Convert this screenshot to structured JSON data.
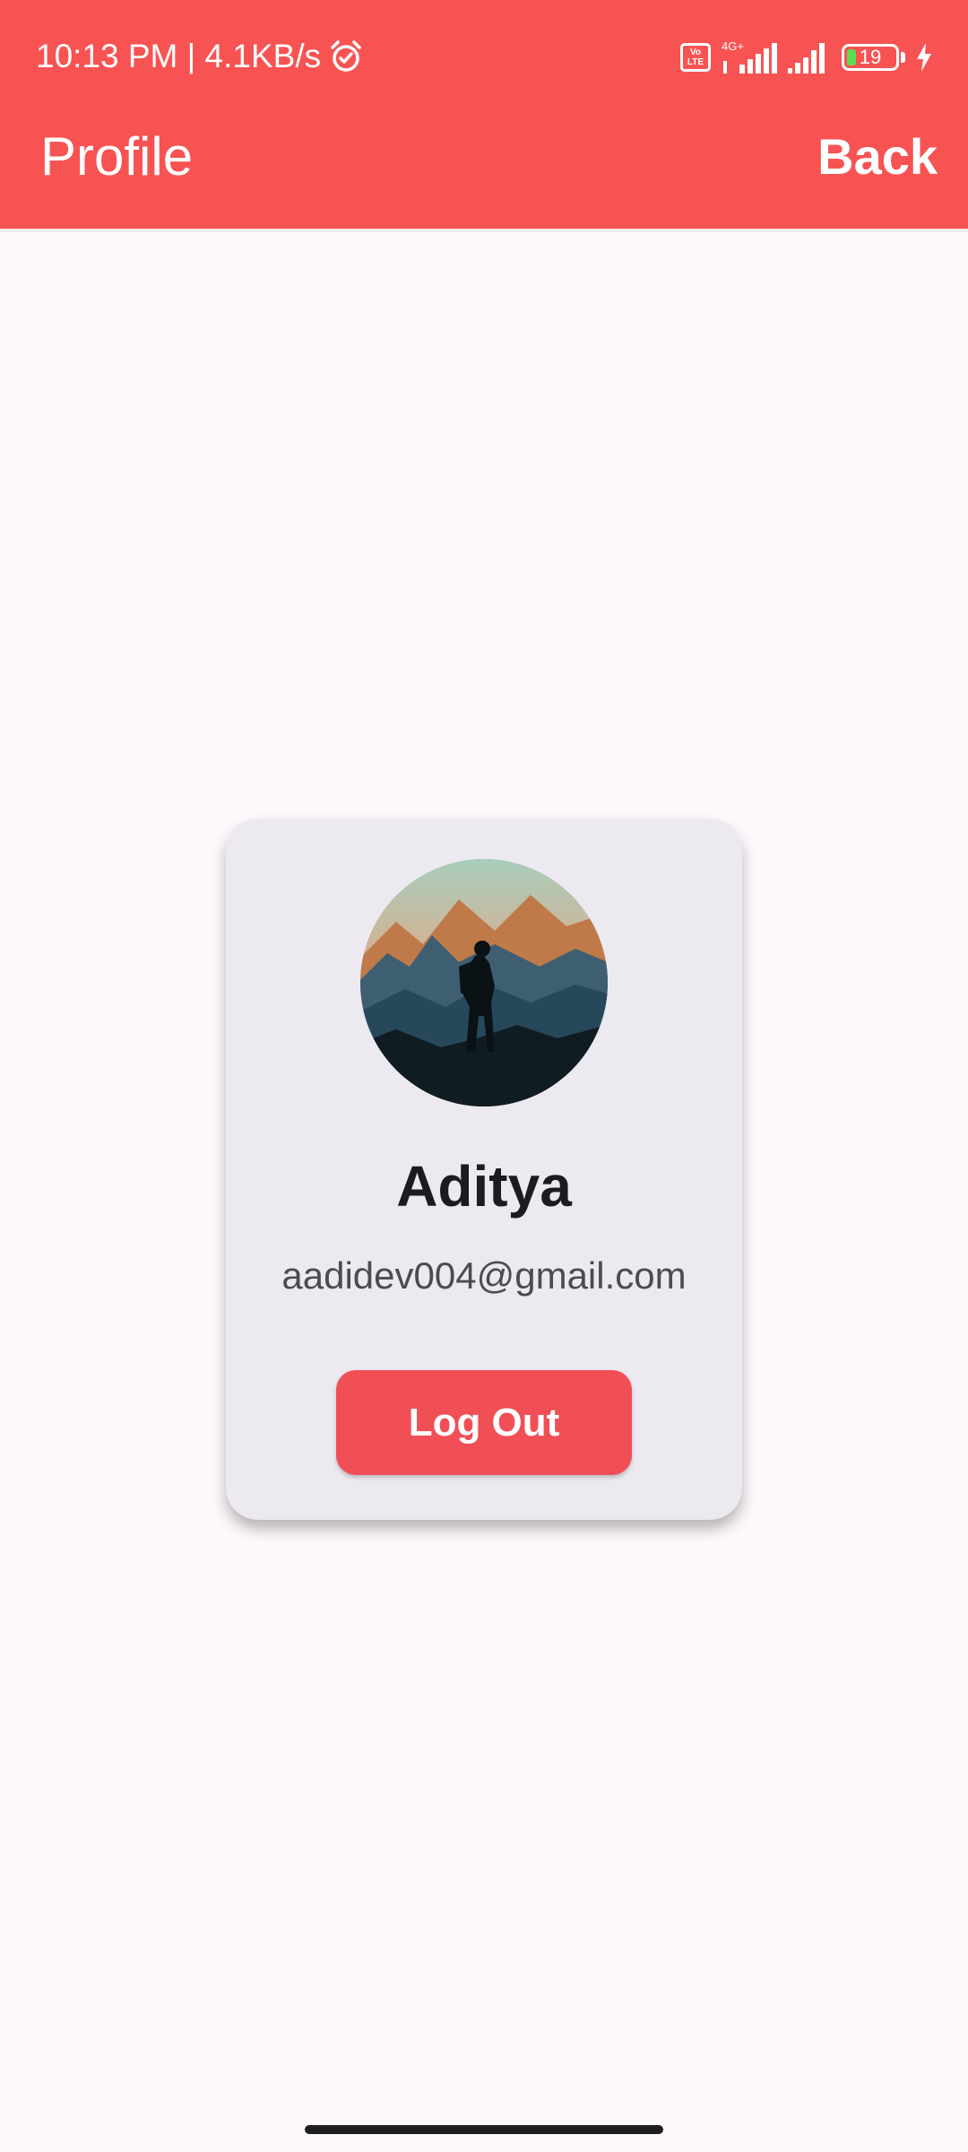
{
  "status_bar": {
    "time_speed": "10:13 PM | 4.1KB/s",
    "volte_label": "Vo LTE",
    "network_label": "4G+",
    "battery_level": "19",
    "icons": [
      "alarm-icon",
      "volte-icon",
      "signal-icon",
      "signal-icon",
      "battery-icon",
      "charging-bolt-icon"
    ]
  },
  "toolbar": {
    "title": "Profile",
    "back_label": "Back",
    "background_color": "#f75352"
  },
  "profile": {
    "avatar_alt": "hiker silhouette in mountains",
    "name": "Aditya",
    "email": "aadidev004@gmail.com",
    "logout_label": "Log Out"
  },
  "colors": {
    "accent": "#f75352",
    "card_background": "#ece9f1",
    "page_background": "#fdf8fb",
    "button": "#f04f56"
  }
}
